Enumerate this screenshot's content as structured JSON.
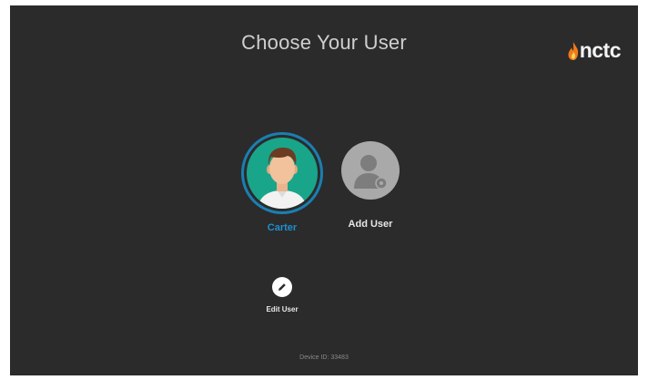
{
  "page": {
    "title": "Choose Your User"
  },
  "brand": {
    "logo_text": "nctc",
    "flame_color": "#f07a1a"
  },
  "users": [
    {
      "label": "Carter",
      "selected": true,
      "icon": "avatar-male-icon"
    },
    {
      "label": "Add User",
      "selected": false,
      "icon": "add-user-icon"
    }
  ],
  "edit_user": {
    "label": "Edit User",
    "icon": "edit-pencil-icon"
  },
  "footer": {
    "device_id": "Device ID: 33483"
  },
  "colors": {
    "background": "#2b2b2b",
    "accent": "#1f8fd0",
    "avatar_bg": "#19a58a"
  }
}
